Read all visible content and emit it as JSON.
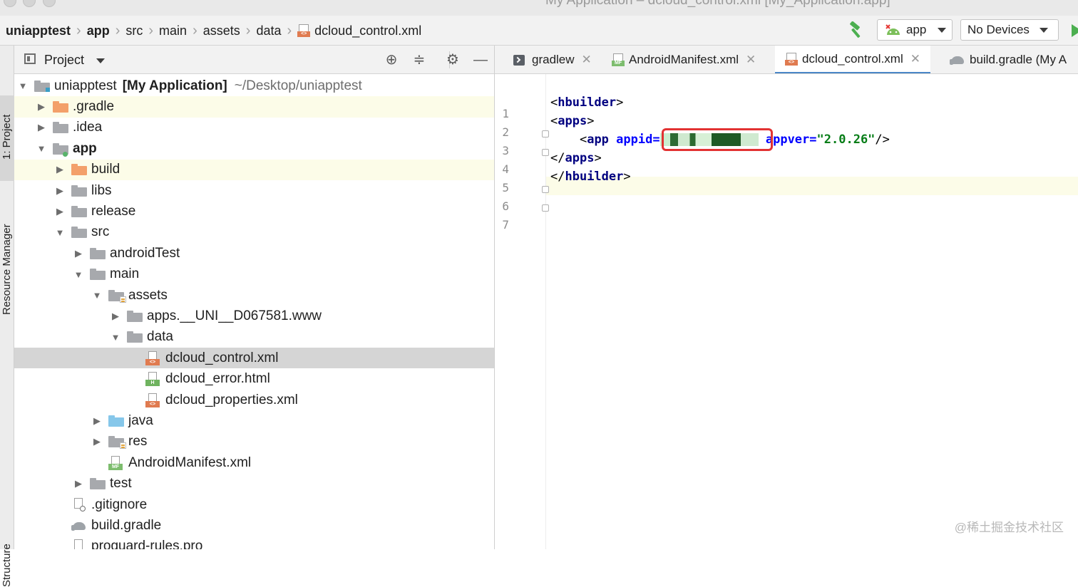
{
  "window": {
    "title": "My Application – dcloud_control.xml [My_Application.app]"
  },
  "breadcrumb": {
    "items": [
      "uniapptest",
      "app",
      "src",
      "main",
      "assets",
      "data",
      "dcloud_control.xml"
    ],
    "file_type": "<>"
  },
  "toolbar": {
    "build_icon": "hammer-icon",
    "run_config": "app",
    "device": "No Devices",
    "run_icon": "play-icon"
  },
  "sidebar": {
    "project_tab": "1: Project",
    "resource_tab": "Resource Manager",
    "structure_tab": "Structure"
  },
  "project_panel": {
    "title": "Project",
    "tree": [
      {
        "label": "uniapptest",
        "bold_suffix": "[My Application]",
        "path": "~/Desktop/uniapptest"
      },
      {
        "label": ".gradle"
      },
      {
        "label": ".idea"
      },
      {
        "label": "app"
      },
      {
        "label": "build"
      },
      {
        "label": "libs"
      },
      {
        "label": "release"
      },
      {
        "label": "src"
      },
      {
        "label": "androidTest"
      },
      {
        "label": "main"
      },
      {
        "label": "assets"
      },
      {
        "label": "apps.__UNI__D067581.www"
      },
      {
        "label": "data"
      },
      {
        "label": "dcloud_control.xml",
        "tag": "<>"
      },
      {
        "label": "dcloud_error.html",
        "tag": "H"
      },
      {
        "label": "dcloud_properties.xml",
        "tag": "<>"
      },
      {
        "label": "java"
      },
      {
        "label": "res"
      },
      {
        "label": "AndroidManifest.xml",
        "tag": "MF"
      },
      {
        "label": "test"
      },
      {
        "label": ".gitignore"
      },
      {
        "label": "build.gradle"
      },
      {
        "label": "proguard-rules.pro"
      }
    ]
  },
  "editor": {
    "tabs": [
      {
        "label": "gradlew"
      },
      {
        "label": "AndroidManifest.xml",
        "tag": "MF"
      },
      {
        "label": "dcloud_control.xml",
        "tag": "<>"
      },
      {
        "label": "build.gradle (My A"
      }
    ],
    "line_numbers": [
      "1",
      "2",
      "3",
      "4",
      "5",
      "6",
      "7"
    ],
    "code": {
      "l2_tag": "hbuilder",
      "l3_tag": "apps",
      "l4_tag": "app",
      "l4_attr1": "appid",
      "l4_attr2": "appver",
      "l4_val2": "\"2.0.26\"",
      "l5_tag": "apps",
      "l6_tag": "hbuilder"
    }
  },
  "watermark": "@稀土掘金技术社区"
}
